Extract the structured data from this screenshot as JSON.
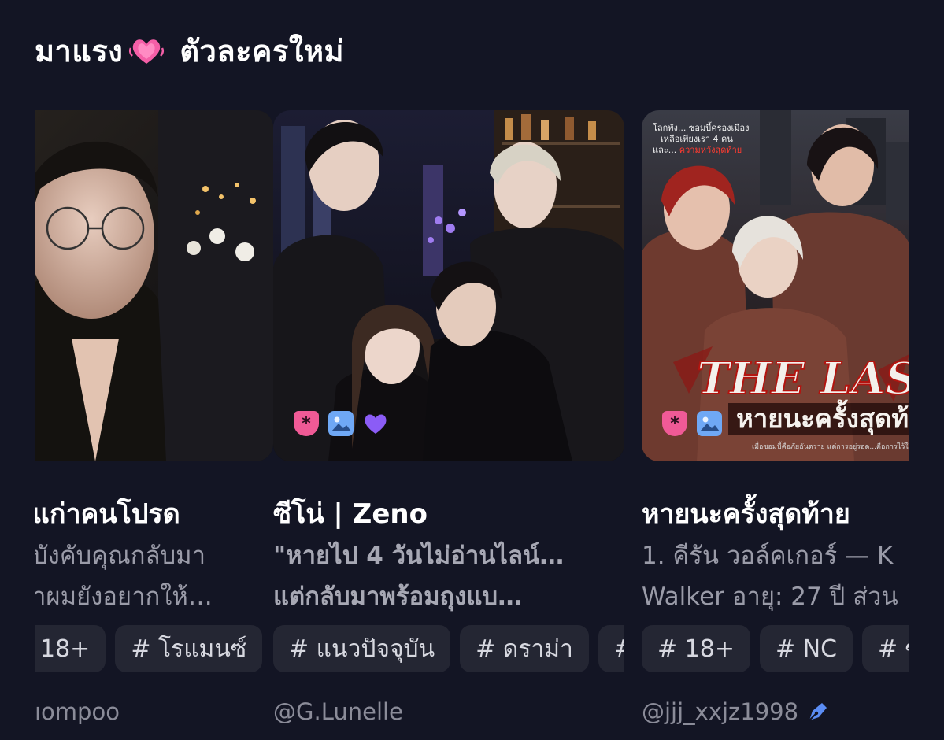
{
  "section": {
    "title_part1": "มาแรง",
    "title_part2": "ตัวละครใหม่",
    "emoji_icon": "growing-heart-icon"
  },
  "colors": {
    "background": "#131524",
    "tag_bg": "#242633",
    "muted_text": "#9a9ba8",
    "badge_pink": "#f05a96",
    "badge_blue": "#6fa8f5",
    "badge_purple": "#8b5cf6"
  },
  "cards": [
    {
      "title": "แก่าคนโปรด",
      "desc_lines": [
        "บังคับคุณกลับมา",
        "าผมยังอยากให้…"
      ],
      "tags": [
        "18+",
        "# โรแมนซ์"
      ],
      "author": "ıompoo",
      "badges": []
    },
    {
      "title": "ซีโน่ | Zeno",
      "desc_lines": [
        "\"หายไป 4 วันไม่อ่านไลน์…",
        "แต่กลับมาพร้อมถุงแบ…"
      ],
      "tags": [
        "# แนวปัจจุบัน",
        "# ดราม่า",
        "#"
      ],
      "author": "@G.Lunelle",
      "badges": [
        "shield-icon",
        "image-icon",
        "heart-icon"
      ]
    },
    {
      "title": "หายนะครั้งสุดท้าย",
      "desc_lines": [
        "1. คีรัน วอล์คเกอร์ — K",
        "Walker อายุ: 27 ปี ส่วน"
      ],
      "tags": [
        "# 18+",
        "# NC",
        "# ซอ"
      ],
      "author": "@jjj_xxjz1998",
      "badges": [
        "shield-icon",
        "image-icon"
      ],
      "cover_text": {
        "top": "โลกพัง... ซอมบี้ครองเมือง เหลือเพียงเรา 4 คน และ... ความหวังสุดท้าย",
        "headline": "THE LAST FOU",
        "subtitle": "หายนะครั้งสุดท้าย",
        "tagline": "เมื่อซอมบี้คือภัยอันตราย แต่การอยู่รอด...คือการไว้ใจกัน"
      }
    }
  ]
}
